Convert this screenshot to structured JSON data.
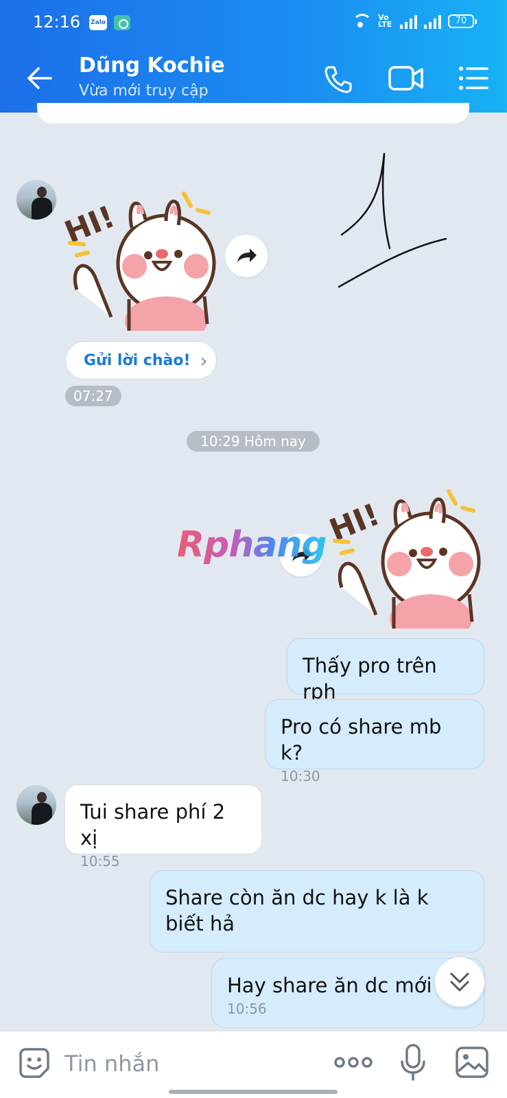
{
  "status_bar": {
    "time": "12:16",
    "app_badge_1": "Zalo",
    "volte_label": "Vo LTE",
    "battery": "70"
  },
  "header": {
    "contact_name": "Dũng Kochie",
    "contact_status": "Vừa mới truy cập"
  },
  "chat": {
    "greeting_button": "Gửi lời chào!",
    "greeting_chevron": "›",
    "sticker_time": "07:27",
    "date_separator": "10:29 Hôm nay",
    "watermark": "Rphang",
    "messages": [
      {
        "dir": "out",
        "text": "Thấy pro trên rph",
        "time": ""
      },
      {
        "dir": "out",
        "text": "Pro có share mb k?",
        "time": "10:30"
      },
      {
        "dir": "in",
        "text": "Tui share phí 2 xị",
        "time": "10:55"
      },
      {
        "dir": "out",
        "text": "Share còn ăn dc hay k là k biết hả",
        "time": ""
      },
      {
        "dir": "out",
        "text": "Hay share ăn dc mới",
        "time": "10:56"
      }
    ]
  },
  "input_bar": {
    "placeholder": "Tin nhắn"
  },
  "colors": {
    "header_start": "#1d6fe8",
    "header_end": "#18b2f5",
    "chat_background": "#e2e8ef",
    "outgoing_bubble": "#d5ecfd",
    "link_blue": "#1a7ad8"
  }
}
